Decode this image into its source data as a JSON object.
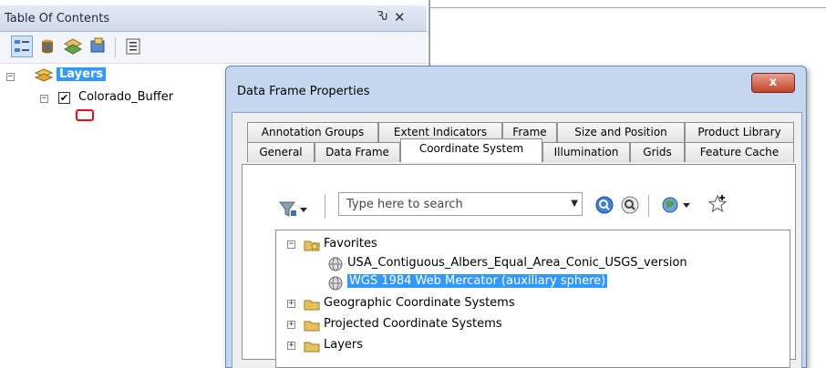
{
  "toc": {
    "title": "Table Of Contents",
    "pin": "Ԅ",
    "close": "✕",
    "tree": {
      "root": {
        "label": "Layers",
        "expander": "−"
      },
      "layer": {
        "label": "Colorado_Buffer",
        "checked": "✔",
        "expander": "−",
        "symbol_color": "#e8111b"
      }
    }
  },
  "dialog": {
    "title": "Data Frame Properties",
    "close": "x",
    "tabs_row1": [
      "Annotation Groups",
      "Extent Indicators",
      "Frame",
      "Size and Position",
      "Product Library"
    ],
    "tabs_row2": [
      "General",
      "Data Frame",
      "Coordinate System",
      "Illumination",
      "Grids",
      "Feature Cache"
    ],
    "active_tab": "Coordinate System",
    "search": {
      "placeholder": "Type here to search",
      "value": ""
    },
    "tree": {
      "favorites": {
        "label": "Favorites",
        "expander": "−"
      },
      "fav_items": [
        "USA_Contiguous_Albers_Equal_Area_Conic_USGS_version",
        "WGS 1984 Web Mercator (auxiliary sphere)"
      ],
      "selected_item": "WGS 1984 Web Mercator (auxiliary sphere)",
      "folders": [
        {
          "label": "Geographic Coordinate Systems",
          "expander": "+"
        },
        {
          "label": "Projected Coordinate Systems",
          "expander": "+"
        },
        {
          "label": "Layers",
          "expander": "+"
        }
      ]
    }
  },
  "colors": {
    "selection": "#3399ff",
    "folder": "#e8c15a",
    "dialog_frame": "#c5d7ef"
  }
}
